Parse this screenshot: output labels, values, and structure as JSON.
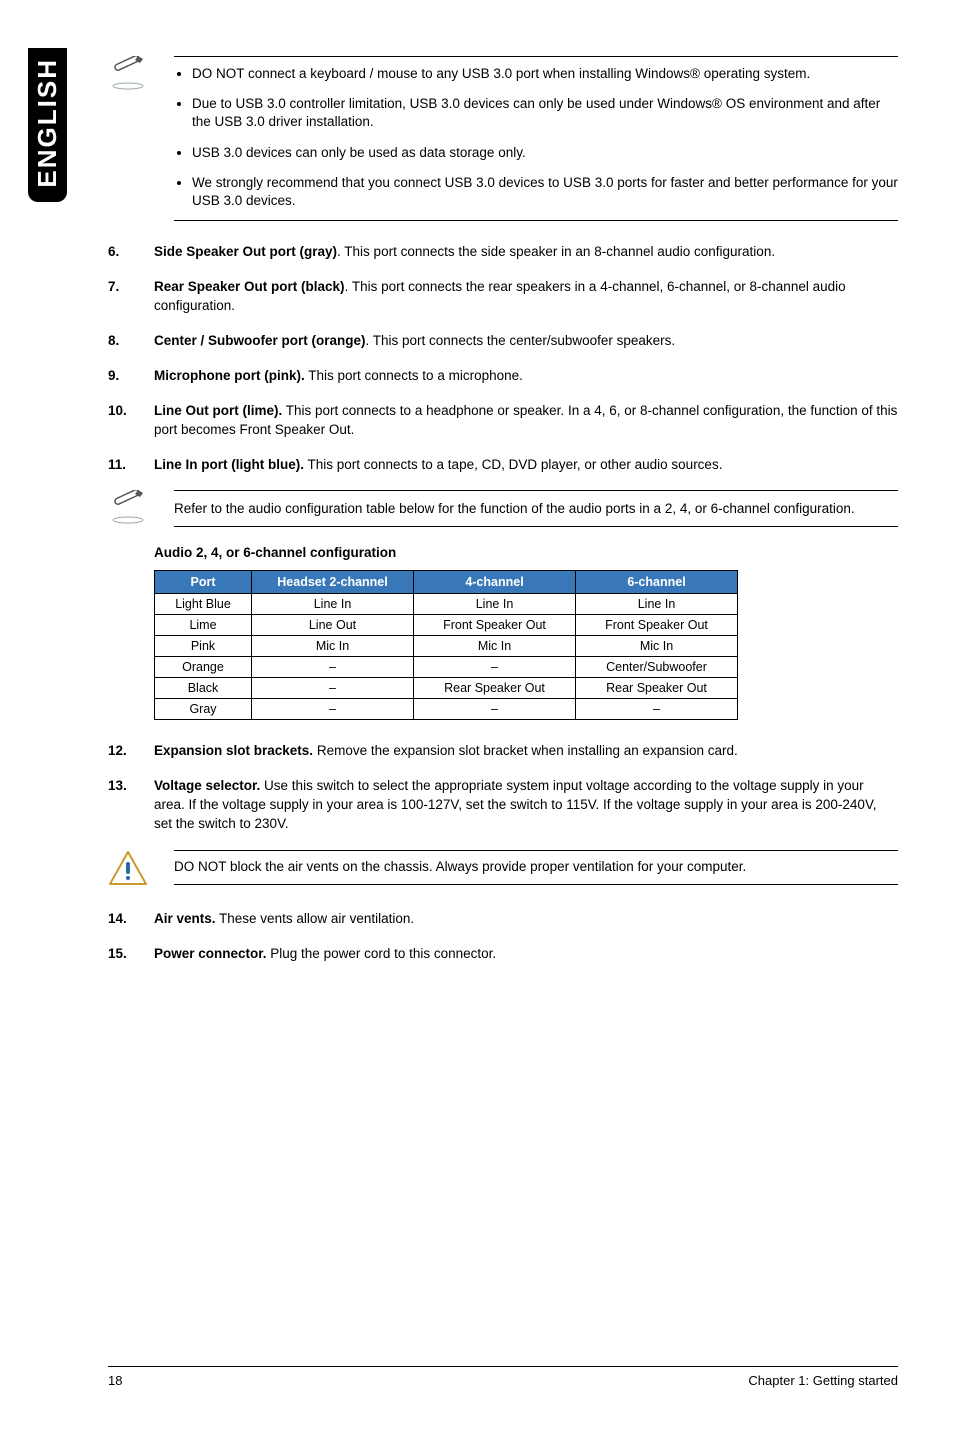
{
  "lang_tab": "ENGLISH",
  "notes_top": [
    "DO NOT connect a keyboard / mouse to any USB 3.0 port when installing Windows® operating system.",
    "Due to USB 3.0 controller limitation, USB 3.0 devices can only be used under Windows® OS environment and after the USB 3.0 driver installation.",
    "USB 3.0 devices can only be used as data storage only.",
    "We strongly recommend that you connect USB 3.0 devices to USB 3.0 ports for faster and better performance for your USB 3.0 devices."
  ],
  "items_a": [
    {
      "n": "6.",
      "title": "Side Speaker Out port (gray)",
      "text": ". This port connects the side speaker in an 8-channel audio configuration."
    },
    {
      "n": "7.",
      "title": "Rear Speaker Out port (black)",
      "text": ". This port connects the rear speakers in a 4-channel, 6-channel, or 8-channel audio configuration."
    },
    {
      "n": "8.",
      "title": "Center / Subwoofer port (orange)",
      "text": ". This port connects the center/subwoofer speakers."
    },
    {
      "n": "9.",
      "title": "Microphone port (pink).",
      "text": " This port connects to a microphone."
    },
    {
      "n": "10.",
      "title": "Line Out port (lime).",
      "text": " This port connects to a headphone or speaker. In a 4, 6, or 8-channel configuration, the function of this port becomes Front Speaker Out."
    },
    {
      "n": "11.",
      "title": "Line In port (light blue).",
      "text": " This port connects to a tape, CD, DVD player, or other audio sources."
    }
  ],
  "note_mid": "Refer to the audio configuration table below for the function of the audio ports in a 2, 4, or 6-channel configuration.",
  "table_heading": "Audio 2, 4, or 6-channel configuration",
  "table": {
    "headers": [
      "Port",
      "Headset 2-channel",
      "4-channel",
      "6-channel"
    ],
    "rows": [
      [
        "Light Blue",
        "Line In",
        "Line In",
        "Line In"
      ],
      [
        "Lime",
        "Line Out",
        "Front Speaker Out",
        "Front Speaker Out"
      ],
      [
        "Pink",
        "Mic In",
        "Mic In",
        "Mic In"
      ],
      [
        "Orange",
        "–",
        "–",
        "Center/Subwoofer"
      ],
      [
        "Black",
        "–",
        "Rear Speaker Out",
        "Rear Speaker Out"
      ],
      [
        "Gray",
        "–",
        "–",
        "–"
      ]
    ]
  },
  "items_b": [
    {
      "n": "12.",
      "title": "Expansion slot brackets.",
      "text": " Remove the expansion slot bracket when installing an expansion card."
    },
    {
      "n": "13.",
      "title": "Voltage selector.",
      "text": " Use this switch to select the appropriate system input voltage according to the voltage supply in your area. If the voltage supply in your area is 100-127V, set the switch to 115V. If the voltage supply in your area is 200-240V, set the switch to 230V."
    }
  ],
  "warn": "DO NOT block the air vents on the chassis. Always provide proper ventilation for your computer.",
  "items_c": [
    {
      "n": "14.",
      "title": "Air vents.",
      "text": " These vents allow air ventilation."
    },
    {
      "n": "15.",
      "title": "Power connector.",
      "text": " Plug the power cord to this connector."
    }
  ],
  "footer_left": "18",
  "footer_right": "Chapter 1: Getting started"
}
